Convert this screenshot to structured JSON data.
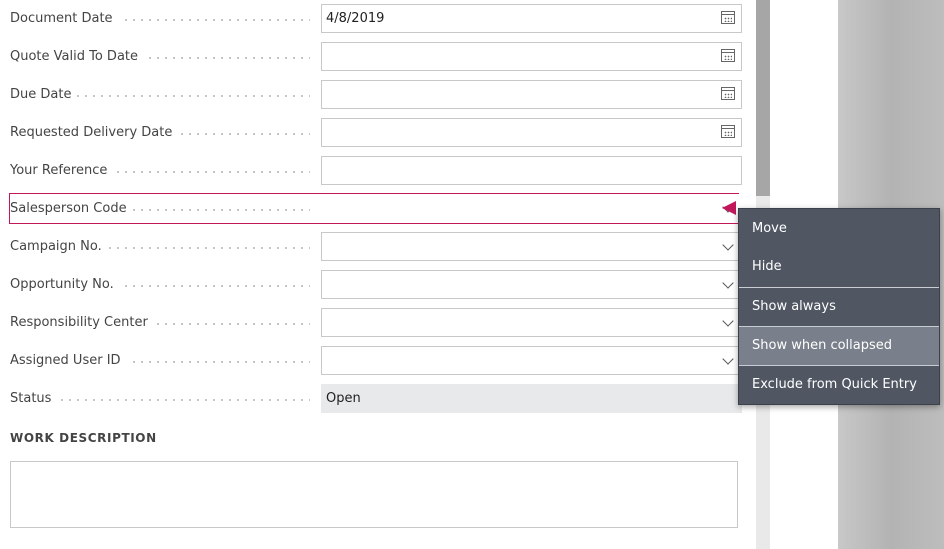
{
  "form": {
    "fields": [
      {
        "label": "Document Date",
        "value": "4/8/2019",
        "type": "date"
      },
      {
        "label": "Quote Valid To Date",
        "value": "",
        "type": "date"
      },
      {
        "label": "Due Date",
        "value": "",
        "type": "date"
      },
      {
        "label": "Requested Delivery Date",
        "value": "",
        "type": "date"
      },
      {
        "label": "Your Reference",
        "value": "",
        "type": "text"
      },
      {
        "label": "Salesperson Code",
        "value": "",
        "type": "lookup"
      },
      {
        "label": "Campaign No.",
        "value": "",
        "type": "lookup"
      },
      {
        "label": "Opportunity No.",
        "value": "",
        "type": "lookup"
      },
      {
        "label": "Responsibility Center",
        "value": "",
        "type": "lookup"
      },
      {
        "label": "Assigned User ID",
        "value": "",
        "type": "lookup"
      },
      {
        "label": "Status",
        "value": "Open",
        "type": "readonly"
      }
    ],
    "work_description_title": "WORK DESCRIPTION",
    "work_description_value": ""
  },
  "context_menu": {
    "items": [
      "Move",
      "Hide",
      "Show always",
      "Show when collapsed",
      "Exclude from Quick Entry"
    ],
    "hovered": "Show when collapsed"
  },
  "colors": {
    "accent": "#c2185b",
    "menu_bg": "#505763",
    "menu_hover": "#7a808b",
    "readonly_bg": "#e8e9eb"
  }
}
